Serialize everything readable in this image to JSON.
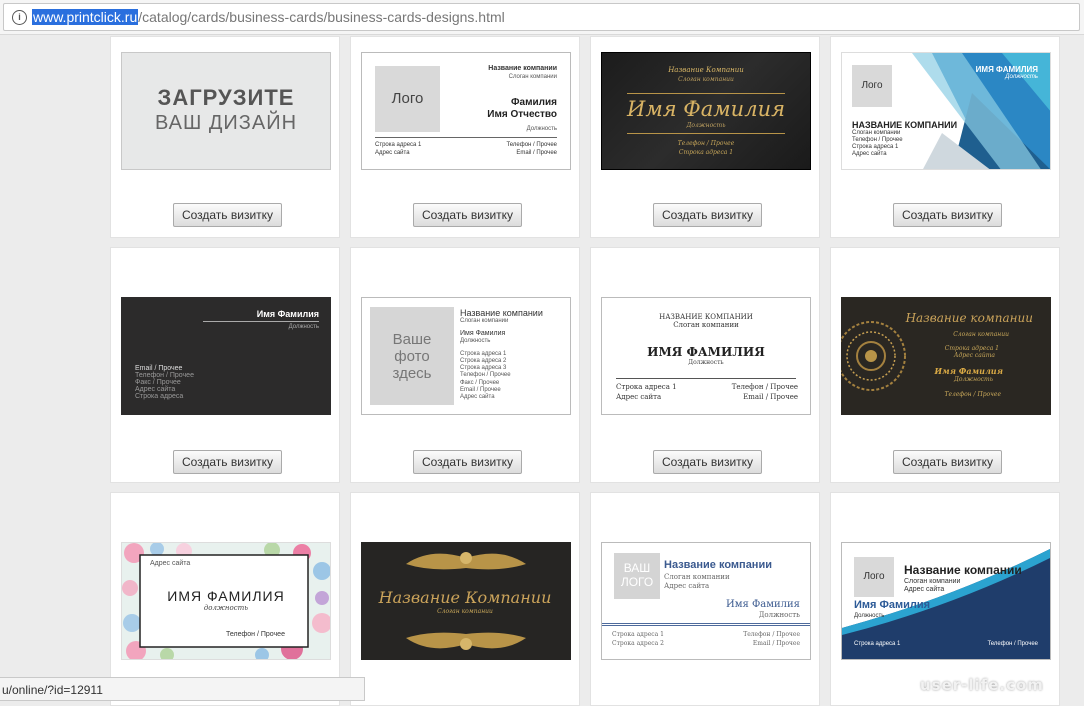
{
  "browser": {
    "url_host": "www.printclick.ru",
    "url_path": "/catalog/cards/business-cards/business-cards-designs.html",
    "status_url": "u/online/?id=12911"
  },
  "button_label": "Создать визитку",
  "cards": {
    "upload": {
      "line1": "ЗАГРУЗИТЕ",
      "line2": "ВАШ ДИЗАЙН"
    },
    "c2": {
      "logo": "Лого",
      "company": "Название компании",
      "slogan": "Слоган компании",
      "surname": "Фамилия",
      "name": "Имя Отчество",
      "position": "Должность",
      "addr": "Строка адреса 1",
      "site": "Адрес сайта",
      "phone": "Телефон / Прочее",
      "email": "Email / Прочее"
    },
    "c3": {
      "company": "Название Компании",
      "slogan": "Слоган компании",
      "name": "Имя Фамилия",
      "position": "Должность",
      "phone": "Телефон / Прочее",
      "misc": "Строка адреса 1"
    },
    "c4": {
      "logo": "Лого",
      "name": "ИМЯ ФАМИЛИЯ",
      "position": "Должность",
      "company": "НАЗВАНИЕ КОМПАНИИ",
      "slogan": "Слоган компании",
      "phone": "Телефон / Прочее",
      "addr": "Строка адреса 1",
      "site": "Адрес сайта"
    },
    "c5": {
      "name": "Имя Фамилия",
      "position": "Должность",
      "email": "Email / Прочее",
      "phone": "Телефон / Прочее",
      "fax": "Факс / Прочее",
      "site": "Адрес сайта",
      "addr": "Строка адреса"
    },
    "c6": {
      "photo1": "Ваше",
      "photo2": "фото",
      "photo3": "здесь",
      "company": "Название компании",
      "slogan": "Слоган компании",
      "name": "Имя Фамилия",
      "position": "Должность",
      "addr1": "Строка адреса 1",
      "addr2": "Строка адреса 2",
      "addr3": "Строка адреса 3",
      "phone": "Телефон / Прочее",
      "fax": "Факс / Прочее",
      "email": "Email / Прочее",
      "site": "Адрес сайта"
    },
    "c7": {
      "company": "НАЗВАНИЕ КОМПАНИИ",
      "slogan": "Слоган компании",
      "name": "ИМЯ ФАМИЛИЯ",
      "position": "Должность",
      "addr": "Строка адреса 1",
      "site": "Адрес сайта",
      "phone": "Телефон / Прочее",
      "email": "Email / Прочее"
    },
    "c8": {
      "company": "Название компании",
      "slogan": "Слоган компании",
      "addr1": "Строка адреса 1",
      "addr2": "Адрес сайта",
      "name": "Имя Фамилия",
      "position": "Должность",
      "phone": "Телефон / Прочее"
    },
    "c9": {
      "site": "Адрес сайта",
      "name": "ИМЯ ФАМИЛИЯ",
      "position": "должность",
      "phone": "Телефон / Прочее"
    },
    "c10": {
      "company": "Название Компании",
      "slogan": "Слоган компании"
    },
    "c11": {
      "logo1": "ВАШ",
      "logo2": "ЛОГО",
      "company": "Название компании",
      "slogan": "Слоган компании",
      "site": "Адрес сайта",
      "name": "Имя Фамилия",
      "position": "Должность",
      "addr1": "Строка адреса 1",
      "addr2": "Строка адреса 2",
      "phone": "Телефон / Прочее",
      "email": "Email / Прочее"
    },
    "c12": {
      "logo": "Лого",
      "company": "Название компании",
      "slogan": "Слоган компании",
      "site": "Адрес сайта",
      "name": "Имя Фамилия",
      "position": "Должность",
      "addr": "Строка адреса 1",
      "phone": "Телефон / Прочее"
    }
  },
  "watermark": "user-life.com",
  "colors": {
    "accent_blue": "#2a6fde",
    "gold": "#c9a85a"
  }
}
